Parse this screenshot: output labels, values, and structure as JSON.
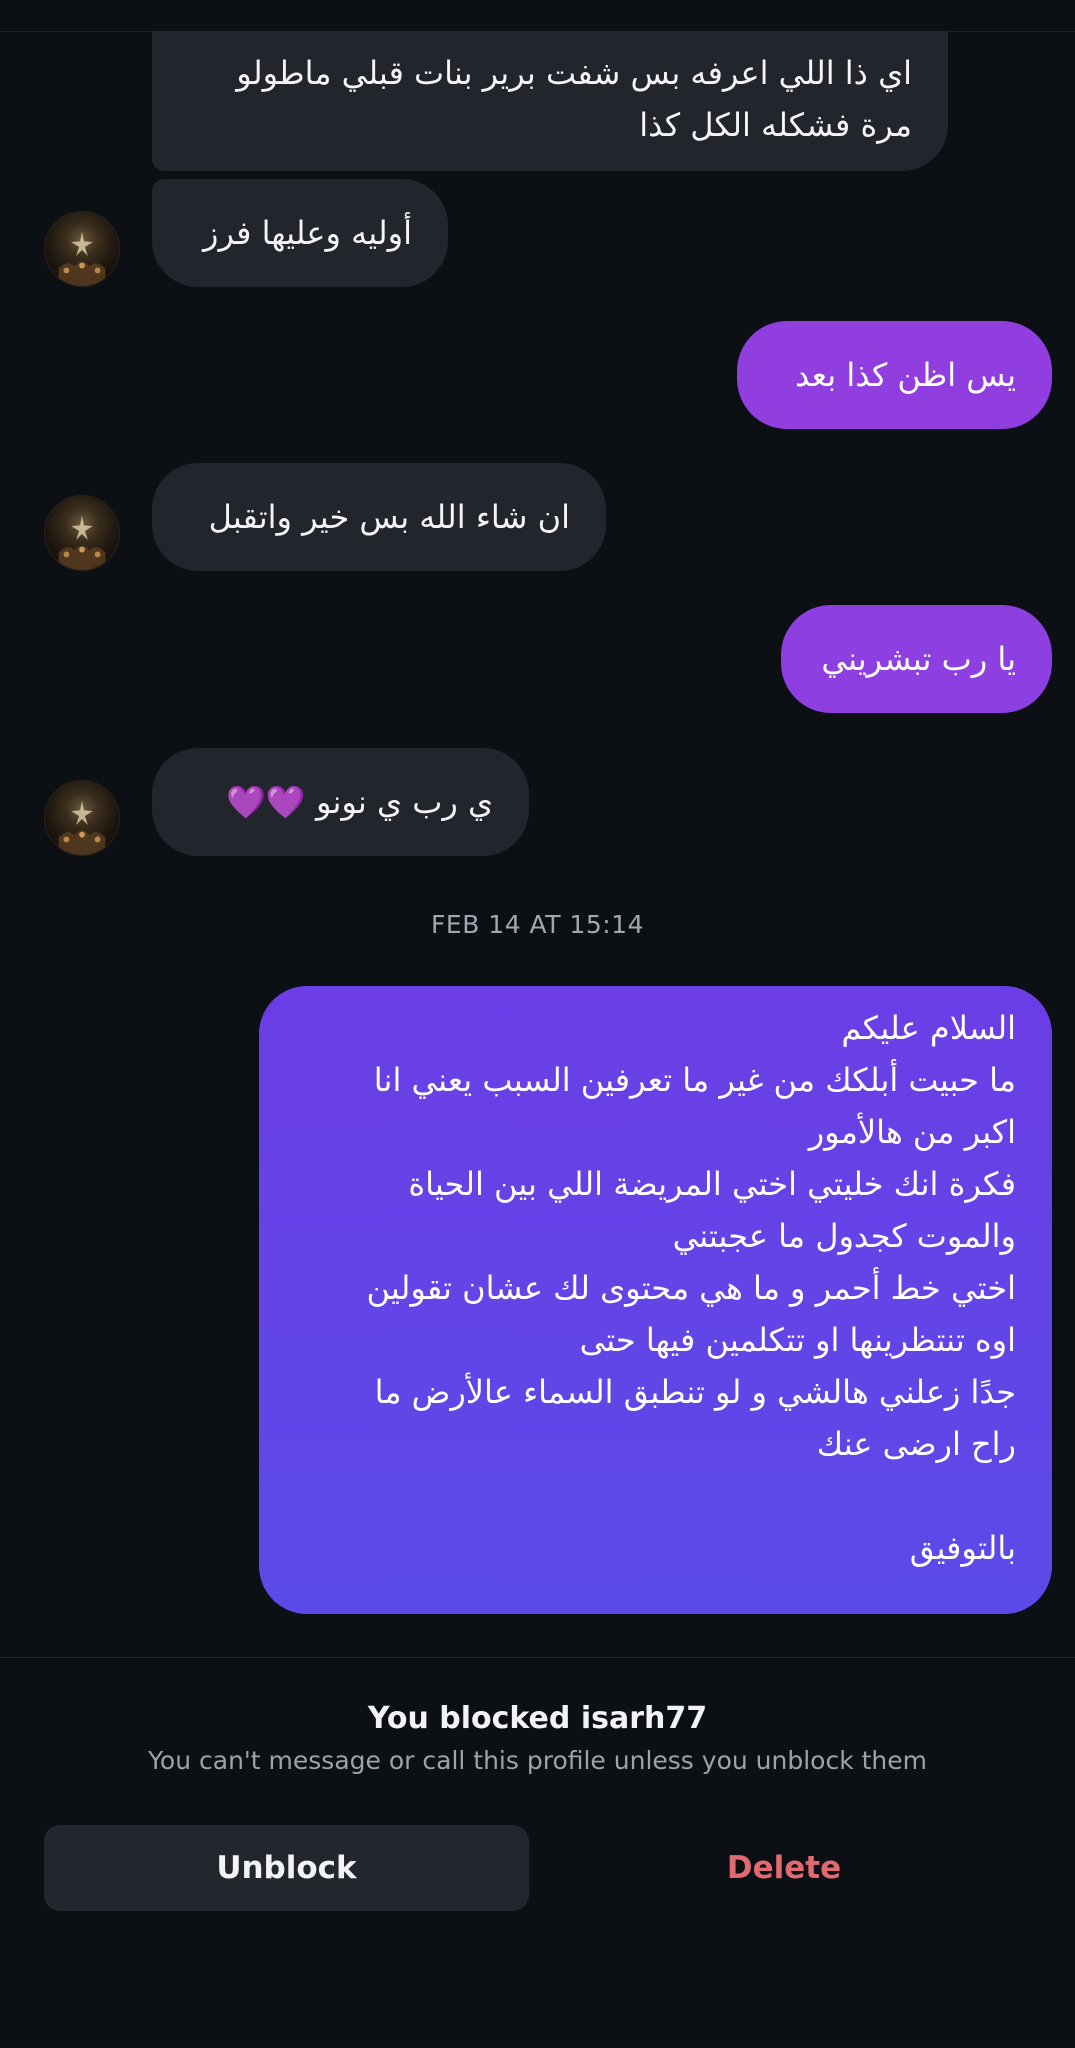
{
  "messages": [
    {
      "id": "m1",
      "direction": "in",
      "text": "اي ذا اللي اعرفه بس شفت برير بنات قبلي ماطولو\nمرة فشكله الكل كذا"
    },
    {
      "id": "m2",
      "direction": "in",
      "text": "أوليه وعليها فرز"
    },
    {
      "id": "m3",
      "direction": "out",
      "text": "يس اظن كذا بعد"
    },
    {
      "id": "m4",
      "direction": "in",
      "text": "ان شاء الله بس خير واتقبل"
    },
    {
      "id": "m5",
      "direction": "out",
      "text": "يا رب تبشريني"
    },
    {
      "id": "m6",
      "direction": "in",
      "text": "ي رب ي نونو 💜💜"
    },
    {
      "id": "m7",
      "direction": "out",
      "text": "السلام عليكم\nما حبيت أبلكك من غير ما تعرفين السبب يعني انا\nاكبر من هالأمور\nفكرة انك خليتي اختي المريضة اللي بين الحياة\nوالموت كجدول ما عجبتني\nاختي خط أحمر و ما هي محتوى لك عشان تقولين\nاوه تنتظرينها او تتكلمين فيها حتى\nجدًا زعلني هالشي و لو تنطبق السماء عالأرض ما\nراح ارضى عنك\n\nبالتوفيق"
    }
  ],
  "timestamp": "FEB 14 AT 15:14",
  "blocked": {
    "title": "You blocked isarh77",
    "subtitle": "You can't message or call this profile unless you unblock them"
  },
  "actions": {
    "unblock_label": "Unblock",
    "delete_label": "Delete"
  },
  "colors": {
    "background": "#0c0f14",
    "incoming_bubble": "#22252b",
    "outgoing_gradient_start": "#8a3fe0",
    "outgoing_gradient_end": "#5b4ae8",
    "delete_text": "#e06a72"
  }
}
